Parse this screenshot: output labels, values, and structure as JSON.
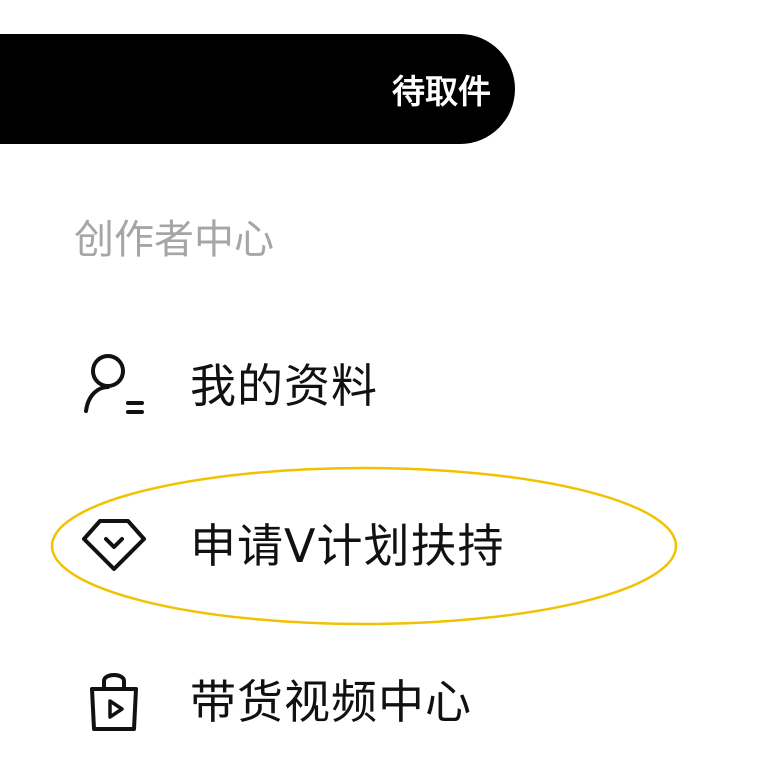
{
  "pickup_banner": {
    "label": "待取件"
  },
  "creator_center": {
    "title": "创作者中心",
    "items": [
      {
        "label": "我的资料",
        "icon": "user-profile-icon"
      },
      {
        "label": "申请V计划扶持",
        "icon": "v-plan-diamond-icon"
      },
      {
        "label": "带货视频中心",
        "icon": "shopping-bag-video-icon"
      }
    ]
  },
  "colors": {
    "banner_bg": "#000000",
    "banner_text": "#ffffff",
    "section_title": "#a6a6a6",
    "item_text": "#111111",
    "highlight": "#f2c200"
  }
}
